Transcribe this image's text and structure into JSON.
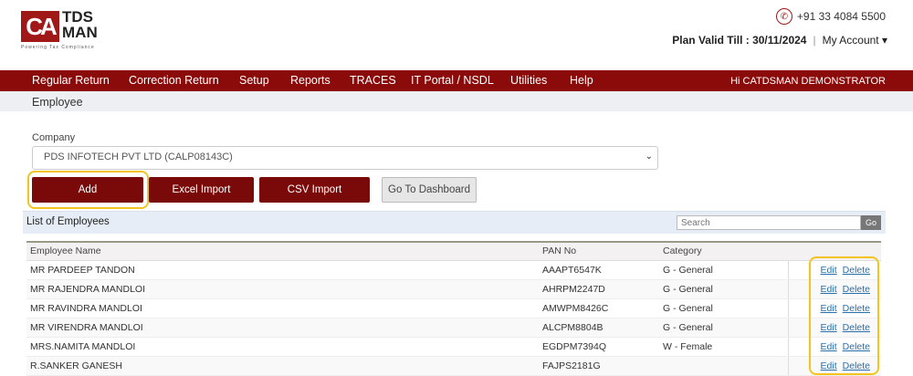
{
  "header": {
    "logo_mark": "CA",
    "logo_text": "TDS MAN",
    "logo_tagline": "Powering Tax Compliance",
    "phone": "+91 33 4084 5500",
    "plan_label": "Plan Valid Till : 30/11/2024",
    "account": "My Account"
  },
  "nav": {
    "items": [
      "Regular Return",
      "Correction Return",
      "Setup",
      "Reports",
      "TRACES",
      "IT Portal / NSDL",
      "Utilities",
      "Help"
    ],
    "greeting": "Hi CATDSMAN DEMONSTRATOR"
  },
  "breadcrumb": "Employee",
  "company": {
    "label": "Company",
    "value": "PDS INFOTECH PVT LTD (CALP08143C)"
  },
  "buttons": {
    "add": "Add",
    "excel": "Excel Import",
    "csv": "CSV Import",
    "dashboard": "Go To Dashboard"
  },
  "list": {
    "title": "List of Employees",
    "search_placeholder": "Search",
    "go": "Go",
    "columns": [
      "Employee Name",
      "PAN No",
      "Category"
    ],
    "edit": "Edit",
    "delete": "Delete",
    "rows": [
      {
        "name": "MR PARDEEP TANDON",
        "pan": "AAAPT6547K",
        "category": "G - General"
      },
      {
        "name": "MR RAJENDRA MANDLOI",
        "pan": "AHRPM2247D",
        "category": "G - General"
      },
      {
        "name": "MR RAVINDRA MANDLOI",
        "pan": "AMWPM8426C",
        "category": "G - General"
      },
      {
        "name": "MR VIRENDRA MANDLOI",
        "pan": "ALCPM8804B",
        "category": "G - General"
      },
      {
        "name": "MRS.NAMITA MANDLOI",
        "pan": "EGDPM7394Q",
        "category": "W - Female"
      },
      {
        "name": "R.SANKER GANESH",
        "pan": "FAJPS2181G",
        "category": ""
      }
    ]
  }
}
